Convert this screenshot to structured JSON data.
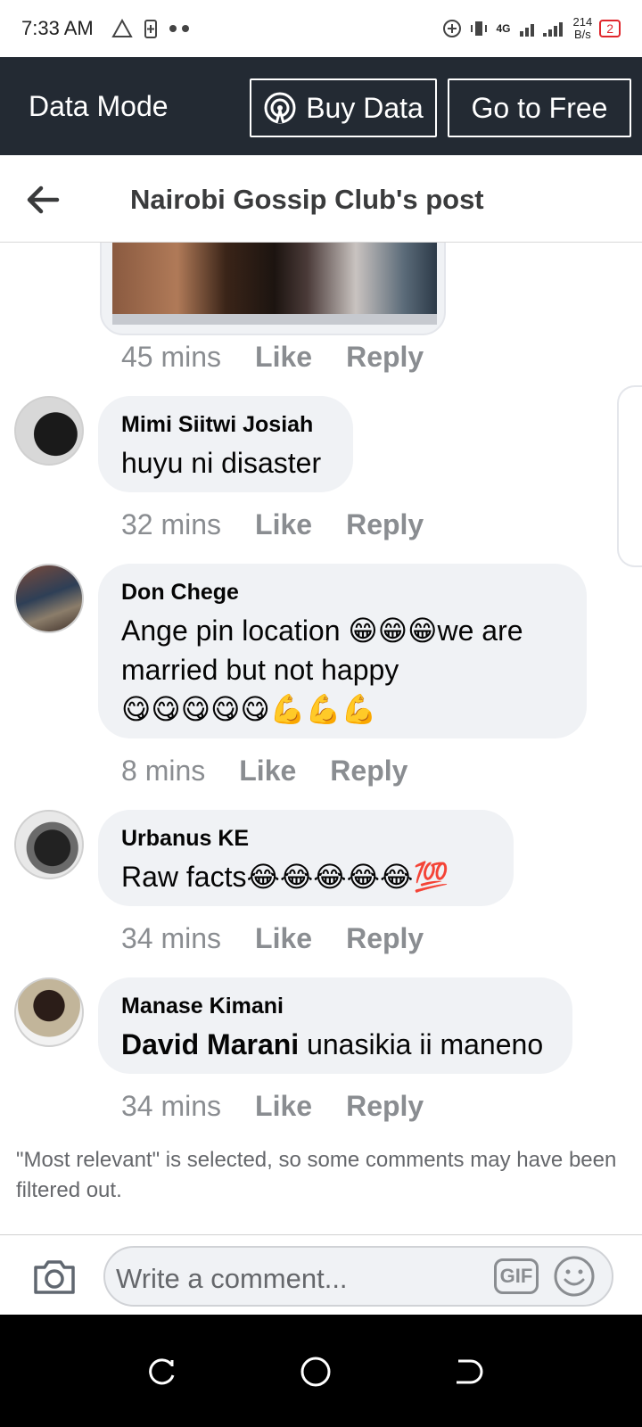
{
  "status_bar": {
    "time": "7:33 AM",
    "speed_value": "214",
    "speed_unit": "B/s",
    "network": "4G",
    "battery": "2",
    "icons": [
      "alert-triangle-icon",
      "battery-saver-icon",
      "dots-icon",
      "add-circle-icon",
      "vibrate-icon",
      "signal-icon"
    ]
  },
  "data_bar": {
    "label": "Data Mode",
    "buy_label": "Buy Data",
    "free_label": "Go to Free"
  },
  "header": {
    "title": "Nairobi Gossip Club's post"
  },
  "comments": [
    {
      "meta": {
        "time": "45 mins",
        "like": "Like",
        "reply": "Reply"
      }
    },
    {
      "author": "Mimi Siitwi Josiah",
      "text": "huyu ni disaster",
      "meta": {
        "time": "32 mins",
        "like": "Like",
        "reply": "Reply"
      }
    },
    {
      "author": "Don Chege",
      "text_line1": "Ange pin location 😁😁😁we are",
      "text_line2": "married but not happy",
      "text_line3": "😋😋😋😋😋💪💪💪",
      "meta": {
        "time": "8 mins",
        "like": "Like",
        "reply": "Reply"
      }
    },
    {
      "author": "Urbanus KE",
      "text": "Raw facts😂😂😂😂😂💯",
      "meta": {
        "time": "34 mins",
        "like": "Like",
        "reply": "Reply"
      }
    },
    {
      "author": "Manase Kimani",
      "mention": "David Marani",
      "text": " unasikia ii maneno",
      "meta": {
        "time": "34 mins",
        "like": "Like",
        "reply": "Reply"
      }
    }
  ],
  "filter_note": "\"Most relevant\" is selected, so some comments may have been filtered out.",
  "composer": {
    "placeholder": "Write a comment...",
    "gif_label": "GIF"
  },
  "colors": {
    "data_bar_bg": "#232a33",
    "bubble_bg": "#f0f2f5",
    "meta_text": "#8a8d91"
  }
}
